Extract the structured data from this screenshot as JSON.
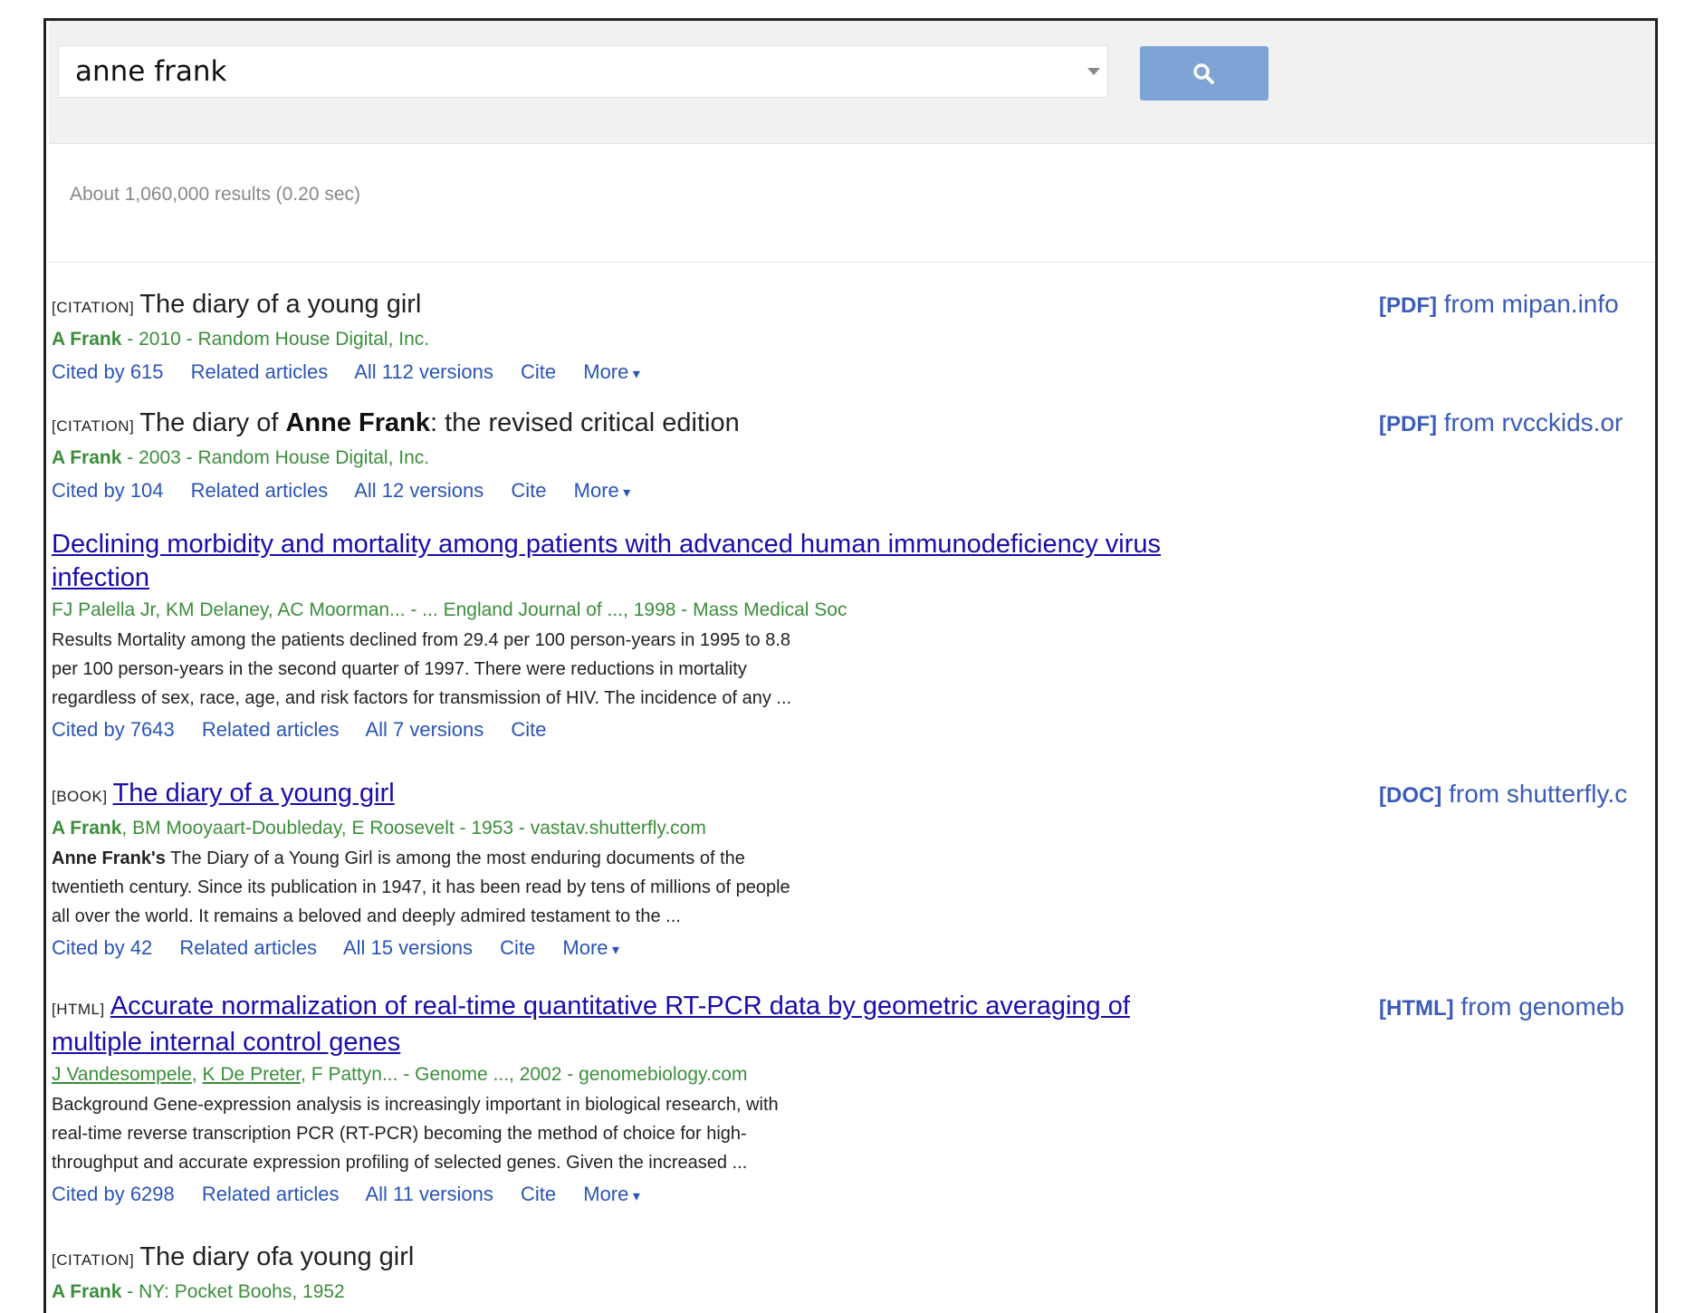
{
  "search": {
    "query": "anne frank"
  },
  "result_stats": "About 1,060,000 results (0.20 sec)",
  "results": [
    {
      "tag": "[CITATION]",
      "title_pre": "The diary of a young girl",
      "title_bold": "",
      "title_post": "",
      "author_bold": "A Frank",
      "author_rest": " - 2010 - Random House Digital, Inc.",
      "links": [
        "Cited by 615",
        "Related articles",
        "All 112 versions",
        "Cite",
        "More"
      ],
      "side": {
        "fmt": "[PDF]",
        "text": " from mipan.info"
      }
    },
    {
      "tag": "[CITATION]",
      "title_pre": "The diary of ",
      "title_bold": "Anne Frank",
      "title_post": ": the revised critical edition",
      "author_bold": "A Frank",
      "author_rest": " - 2003 - Random House Digital, Inc.",
      "links": [
        "Cited by 104",
        "Related articles",
        "All 12 versions",
        "Cite",
        "More"
      ],
      "side": {
        "fmt": "[PDF]",
        "text": " from rvcckids.or"
      }
    },
    {
      "title_line1": "Declining morbidity and mortality among patients with advanced human immunodeficiency virus",
      "title_line2": "infection",
      "authors": "FJ Palella Jr, KM Delaney, AC Moorman... - ... England Journal of ..., 1998 - Mass Medical Soc",
      "snippet": [
        "Results Mortality among the patients declined from 29.4 per 100 person-years in 1995 to 8.8",
        "per 100 person-years in the second quarter of 1997. There were reductions in mortality",
        "regardless of sex, race, age, and risk factors for transmission of HIV. The incidence of any ..."
      ],
      "links": [
        "Cited by 7643",
        "Related articles",
        "All 7 versions",
        "Cite"
      ]
    },
    {
      "tag": "[BOOK]",
      "title": "The diary of a young girl",
      "author_bold": "A Frank",
      "author_rest": ", BM Mooyaart-Doubleday, E Roosevelt - 1953 - vastav.shutterfly.com",
      "snippet_bold": "Anne Frank's",
      "snippet": [
        " The Diary of a Young Girl is among the most enduring documents of the",
        "twentieth century. Since its publication in 1947, it has been read by tens of millions of people",
        "all over the world. It remains a beloved and deeply admired testament to the ..."
      ],
      "links": [
        "Cited by 42",
        "Related articles",
        "All 15 versions",
        "Cite",
        "More"
      ],
      "side": {
        "fmt": "[DOC]",
        "text": " from shutterfly.c"
      }
    },
    {
      "tag": "[HTML]",
      "title_line1": "Accurate normalization of real-time quantitative RT-PCR data by geometric averaging of",
      "title_line2": "multiple internal control genes",
      "author_link1": "J Vandesompele",
      "author_link2": "K De Preter",
      "author_rest": ", F Pattyn... - Genome ..., 2002 - genomebiology.com",
      "snippet": [
        "Background Gene-expression analysis is increasingly important in biological research, with",
        "real-time reverse transcription PCR (RT-PCR) becoming the method of choice for high-",
        "throughput and accurate expression profiling of selected genes. Given the increased ..."
      ],
      "links": [
        "Cited by 6298",
        "Related articles",
        "All 11 versions",
        "Cite",
        "More"
      ],
      "side": {
        "fmt": "[HTML]",
        "text": " from genomeb"
      }
    },
    {
      "tag": "[CITATION]",
      "title": "The diary ofa young girl",
      "author_bold": "A Frank",
      "author_rest": " - NY: Pocket Boohs, 1952"
    }
  ]
}
